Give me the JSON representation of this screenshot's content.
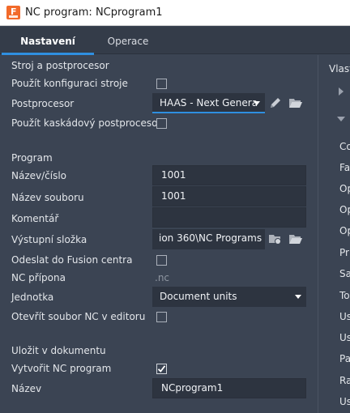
{
  "window": {
    "title": "NC program: NCprogram1"
  },
  "tabs": [
    {
      "label": "Nastavení",
      "active": true
    },
    {
      "label": "Operace",
      "active": false
    }
  ],
  "machine_section": {
    "heading": "Stroj a postprocesor",
    "use_machine_config": {
      "label": "Použít konfiguraci stroje",
      "checked": false
    },
    "postprocessor": {
      "label": "Postprocesor",
      "value": "HAAS - Next Genera"
    },
    "use_cascading_post": {
      "label": "Použít kaskádový postprocesor",
      "checked": false
    }
  },
  "program_section": {
    "heading": "Program",
    "name_number": {
      "label": "Název/číslo",
      "value": "1001"
    },
    "file_name": {
      "label": "Název souboru",
      "value": "1001"
    },
    "comment": {
      "label": "Komentář",
      "value": ""
    },
    "output_folder": {
      "label": "Výstupní složka",
      "value": "ion 360\\NC Programs"
    },
    "send_to_fusion": {
      "label": "Odeslat do Fusion centra",
      "checked": false
    },
    "nc_extension": {
      "label": "NC přípona",
      "value": ".nc"
    },
    "unit": {
      "label": "Jednotka",
      "value": "Document units"
    },
    "open_in_editor": {
      "label": "Otevřít soubor NC v editoru",
      "checked": false
    }
  },
  "document_section": {
    "heading": "Uložit v dokumentu",
    "create_nc_program": {
      "label": "Vytvořit NC program",
      "checked": true
    },
    "name": {
      "label": "Název",
      "value": "NCprogram1"
    }
  },
  "right_panel": {
    "heading": "Vlast",
    "items": [
      "Co",
      "Fa",
      "Op",
      "Op",
      "Op",
      "Pr",
      "Sa",
      "To",
      "Us",
      "Us",
      "Pa",
      "Ra",
      "Us"
    ]
  },
  "colors": {
    "accent": "#2f8fe0",
    "panel_bg": "#3b4453",
    "field_bg": "#2d3440",
    "brand": "#f26a2a"
  },
  "icons": {
    "app": "fusion-app-icon",
    "edit": "pencil-icon",
    "folder": "folder-open-icon",
    "folder_sync": "folder-cloud-icon"
  }
}
